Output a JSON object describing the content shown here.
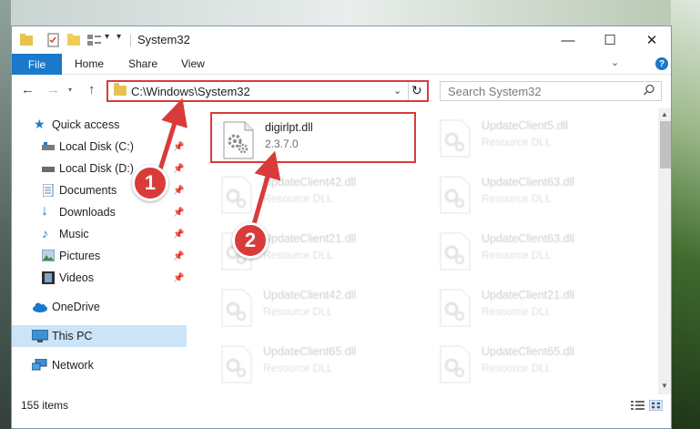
{
  "window": {
    "title": "System32",
    "controls": {
      "minimize": "—",
      "maximize": "☐",
      "close": "✕"
    }
  },
  "ribbon": {
    "tabs": [
      "File",
      "Home",
      "Share",
      "View"
    ],
    "help": "?"
  },
  "address_bar": {
    "path": "C:\\Windows\\System32",
    "search_placeholder": "Search System32"
  },
  "sidebar": {
    "items": [
      {
        "label": "Quick access",
        "icon": "star-icon",
        "pinned": false
      },
      {
        "label": "Local Disk (C:)",
        "icon": "drive-icon",
        "pinned": true
      },
      {
        "label": "Local Disk (D:)",
        "icon": "drive-icon",
        "pinned": true
      },
      {
        "label": "Documents",
        "icon": "documents-icon",
        "pinned": true
      },
      {
        "label": "Downloads",
        "icon": "download-icon",
        "pinned": true
      },
      {
        "label": "Music",
        "icon": "music-icon",
        "pinned": true
      },
      {
        "label": "Pictures",
        "icon": "pictures-icon",
        "pinned": true
      },
      {
        "label": "Videos",
        "icon": "videos-icon",
        "pinned": true
      },
      {
        "label": "OneDrive",
        "icon": "cloud-icon",
        "pinned": false
      },
      {
        "label": "This PC",
        "icon": "computer-icon",
        "pinned": false,
        "selected": true
      },
      {
        "label": "Network",
        "icon": "network-icon",
        "pinned": false
      }
    ]
  },
  "files": [
    {
      "name": "digirlpt.dll",
      "detail": "2.3.7.0",
      "highlighted": true
    },
    {
      "name": "UpdateClient5.dll",
      "detail": "Resource DLL",
      "faded": true
    },
    {
      "name": "UpdateClient42.dll",
      "detail": "Resource DLL",
      "faded": true
    },
    {
      "name": "UpdateClient63.dll",
      "detail": "Resource DLL",
      "faded": true
    },
    {
      "name": "UpdateClient21.dll",
      "detail": "Resource DLL",
      "faded": true
    },
    {
      "name": "UpdateClient63.dll",
      "detail": "Resource DLL",
      "faded": true
    },
    {
      "name": "UpdateClient42.dll",
      "detail": "Resource DLL",
      "faded": true
    },
    {
      "name": "UpdateClient21.dll",
      "detail": "Resource DLL",
      "faded": true
    },
    {
      "name": "UpdateClient65.dll",
      "detail": "Resource DLL",
      "faded": true
    },
    {
      "name": "UpdateClient65.dll",
      "detail": "Resource DLL",
      "faded": true
    }
  ],
  "status": {
    "item_count": "155 items"
  },
  "annotations": {
    "callout_1": "1",
    "callout_2": "2"
  },
  "colors": {
    "accent": "#1979ca",
    "annotation": "#d93b3b",
    "selected": "#cce4f7"
  }
}
